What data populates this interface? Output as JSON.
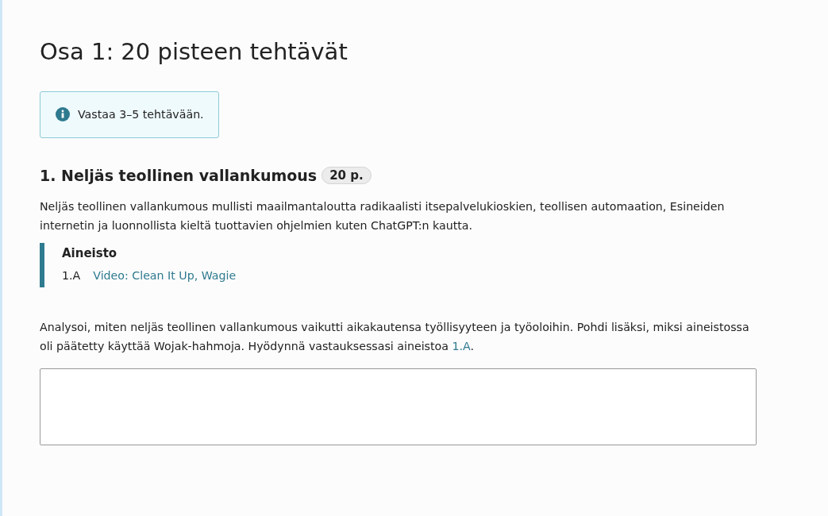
{
  "heading": "Osa 1: 20 pisteen tehtävät",
  "notice": {
    "kind": "info",
    "text": "Vastaa 3–5 tehtävään."
  },
  "question": {
    "title": "1. Neljäs teollinen vallankumous",
    "points": "20 p.",
    "intro": "Neljäs teollinen vallankumous mullisti maailmantaloutta radikaalisti itsepalvelukioskien, teollisen automaation, Esineiden internetin ja luonnollista kieltä tuottavien ohjelmien kuten ChatGPT:n kautta.",
    "material": {
      "title": "Aineisto",
      "items": [
        {
          "label": "1.A",
          "link": "Video: Clean It Up, Wagie"
        }
      ]
    },
    "prompt": {
      "before": "Analysoi, miten neljäs teollinen vallankumous vaikutti aikakautensa työllisyyteen ja työoloihin. Pohdi lisäksi, miksi aineistossa oli päätetty käyttää Wojak-hahmoja. Hyödynnä vastauksessasi aineistoa ",
      "link": "1.A",
      "after": "."
    }
  }
}
